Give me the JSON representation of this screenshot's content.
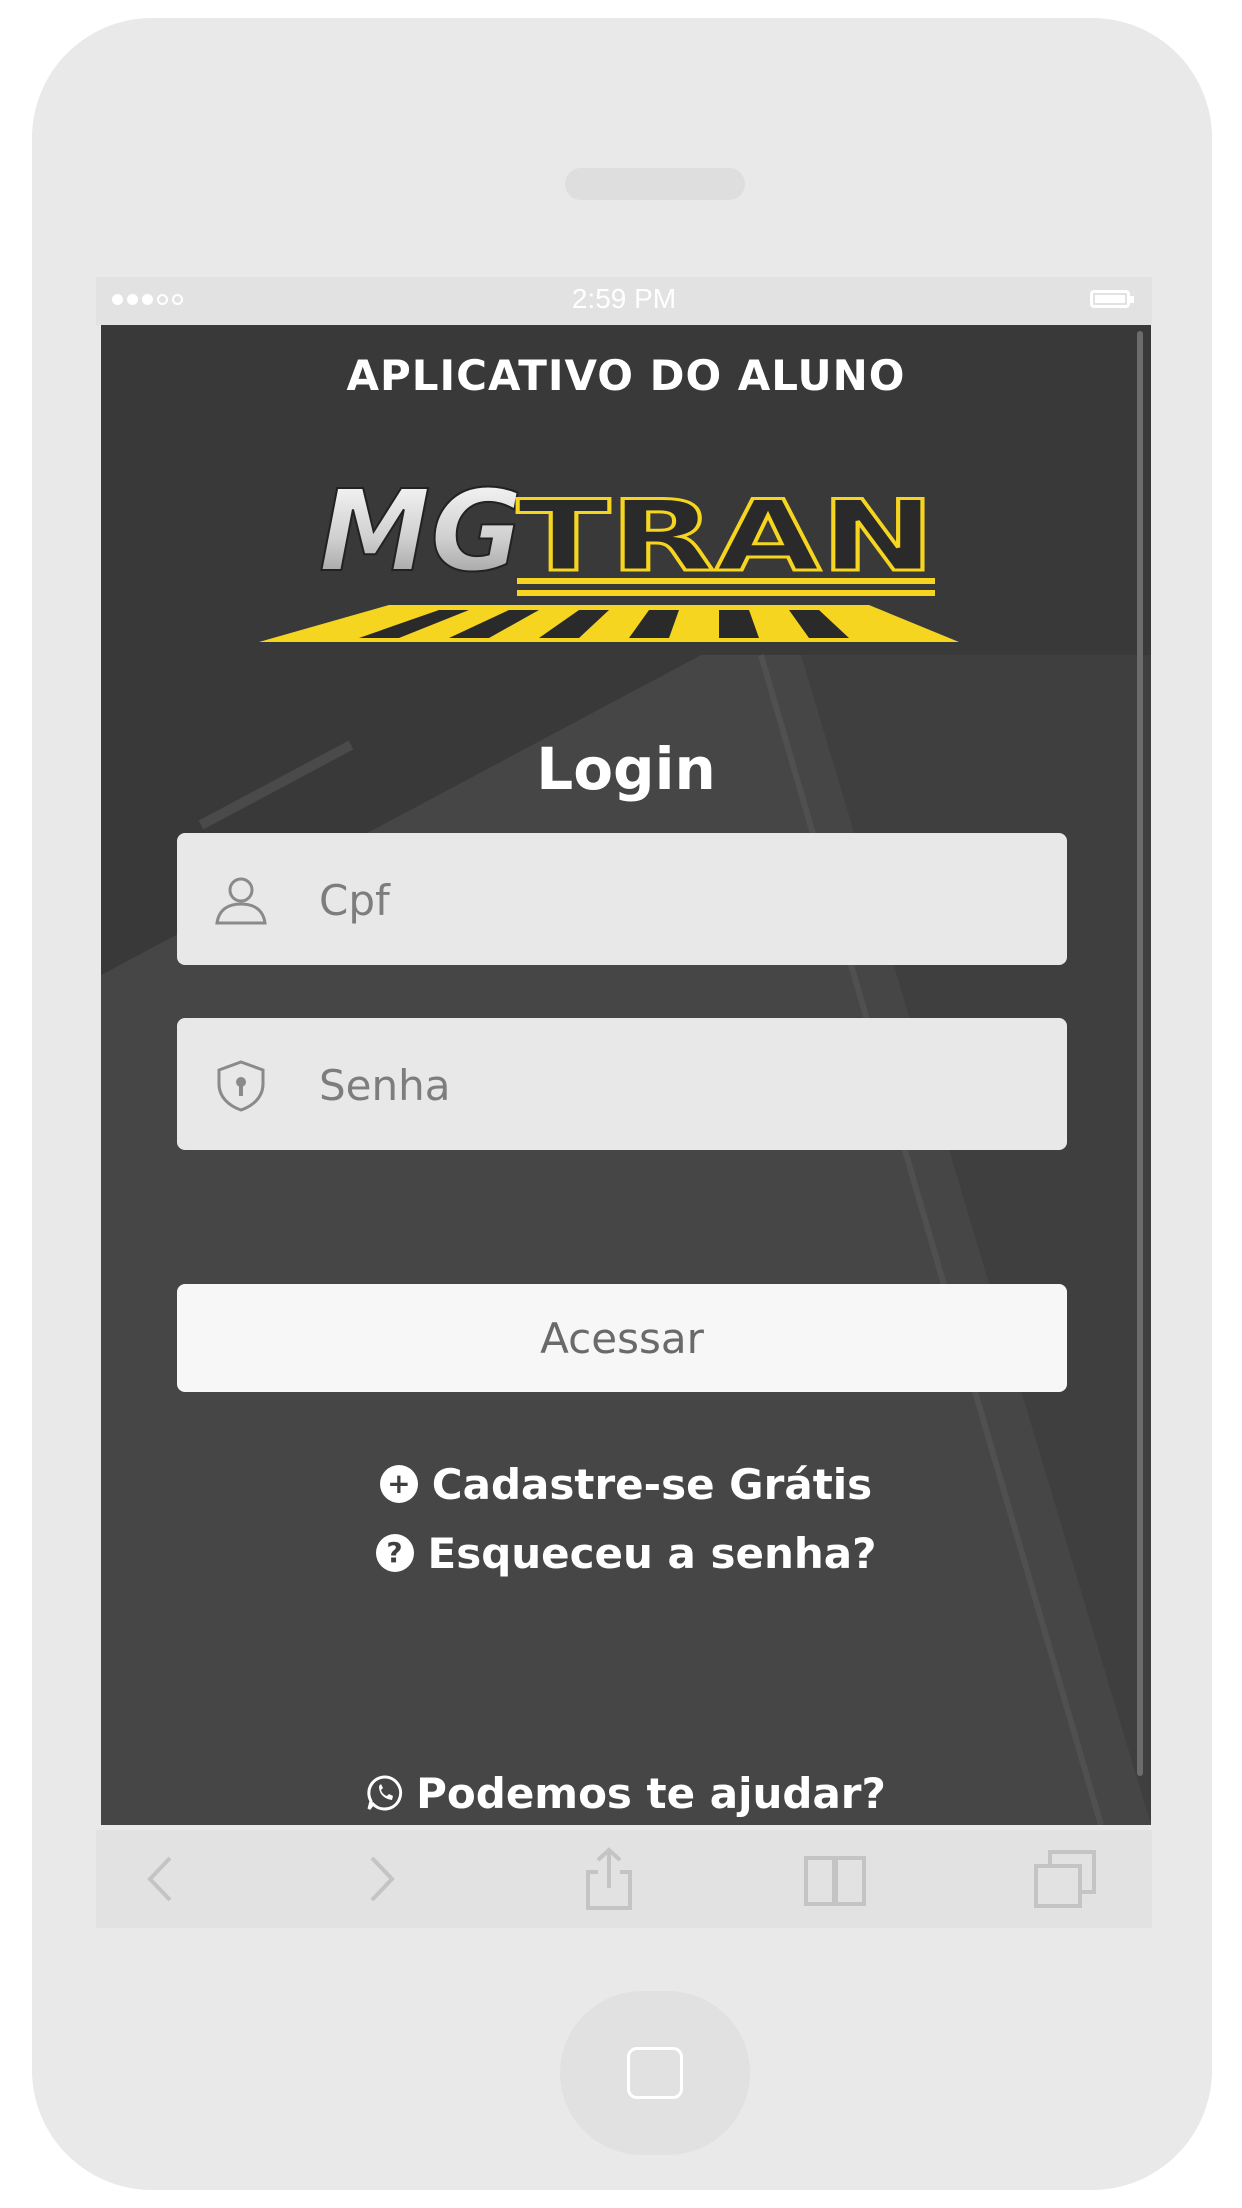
{
  "status_bar": {
    "time": "2:59 PM"
  },
  "app": {
    "title": "APLICATIVO DO ALUNO",
    "logo_text_left": "MG",
    "logo_text_right": "TRAN",
    "login_title": "Login"
  },
  "form": {
    "cpf_placeholder": "Cpf",
    "senha_placeholder": "Senha",
    "submit_label": "Acessar"
  },
  "links": {
    "register": "Cadastre-se Grátis",
    "forgot": "Esqueceu a senha?",
    "help": "Podemos te ajudar?"
  },
  "icons": {
    "cpf": "user-icon",
    "senha": "shield-lock-icon",
    "register": "plus-circle-icon",
    "forgot": "question-circle-icon",
    "help": "whatsapp-icon"
  },
  "colors": {
    "brand_yellow": "#f5d520",
    "screen_background": "#3f3f3f",
    "device_frame": "#e9e9e9"
  }
}
